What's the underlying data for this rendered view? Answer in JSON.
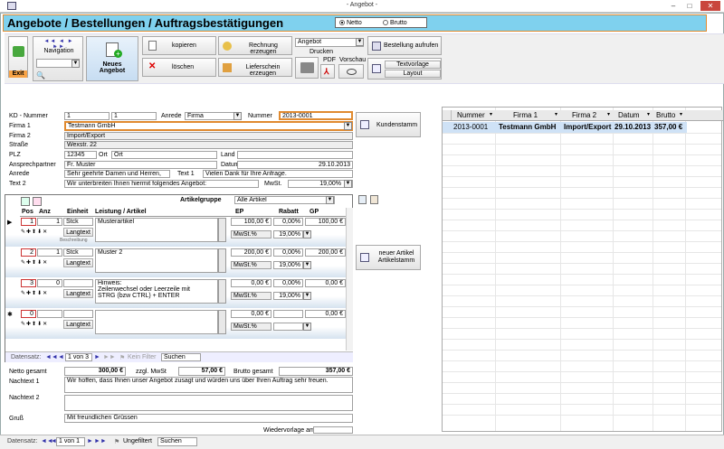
{
  "window": {
    "title": "- Angebot -",
    "min": "–",
    "max": "□",
    "close": "✕"
  },
  "header": {
    "title": "Angebote / Bestellungen / Auftragsbestätigungen",
    "netto": "Netto",
    "brutto": "Brutto"
  },
  "toolbar": {
    "exit": "Exit",
    "navigation": "Navigation",
    "neues_angebot": "Neues\nAngebot",
    "kopieren": "kopieren",
    "loeschen": "löschen",
    "rechnung": "Rechnung erzeugen",
    "lieferschein": "Lieferschein erzeugen",
    "angebot_select": "Angebot",
    "drucken": "Drucken",
    "pdf": "PDF",
    "vorschau": "Vorschau",
    "bestellung": "Bestellung aufrufen",
    "textvorlage": "Textvorlage",
    "layout": "Layout"
  },
  "form": {
    "kd_nummer_label": "KD - Nummer",
    "kd1": "1",
    "kd2": "1",
    "anrede_label": "Anrede",
    "anrede": "Firma",
    "nummer_label": "Nummer",
    "nummer": "2013-0001",
    "firma1_label": "Firma 1",
    "firma1": "Testmann GmbH",
    "firma2_label": "Firma 2",
    "firma2": "Import/Export",
    "strasse_label": "Straße",
    "strasse": "Wexstr. 22",
    "plz_label": "PLZ",
    "plz": "12345",
    "ort_label": "Ort",
    "ort": "Ort",
    "land_label": "Land",
    "ansprech_label": "Ansprechpartner",
    "ansprech": "Fr. Muster",
    "datum_label": "Datum",
    "datum": "29.10.2013",
    "anrede2_label": "Anrede",
    "anrede2": "Sehr geehrte Damen und Herren,",
    "text1_label": "Text 1",
    "text1": "Vielen Dank für Ihre Anfrage.",
    "text2_label": "Text 2",
    "text2": "Wir unterbreiten Ihnen hiermit folgendes Angebot:",
    "mwst_label": "MwSt.",
    "mwst": "19,00%",
    "kundenstamm": "Kundenstamm",
    "neuer_artikel": "neuer Artikel\nArtikelstamm"
  },
  "sub": {
    "artikelgruppe_label": "Artikelgruppe",
    "artikelgruppe": "Alle Artikel",
    "cols": [
      "Pos",
      "Anz",
      "Einheit",
      "Leistung / Artikel",
      "EP",
      "Rabatt",
      "GP"
    ],
    "rows": [
      {
        "pos": "1",
        "anz": "1",
        "einheit": "Stck",
        "text": "Musterartikel",
        "ep": "100,00 €",
        "rabatt": "0,00%",
        "gp": "100,00 €",
        "mwst": "19,00%",
        "langtext": "Langtext",
        "sub": "Beschreibung"
      },
      {
        "pos": "2",
        "anz": "1",
        "einheit": "Stck",
        "text": "Muster 2",
        "ep": "200,00 €",
        "rabatt": "0,00%",
        "gp": "200,00 €",
        "mwst": "19,00%",
        "langtext": "Langtext",
        "sub": ""
      },
      {
        "pos": "3",
        "anz": "0",
        "einheit": "",
        "text": "Hinweis:\nZeilenwechsel oder Leerzeile mit\nSTRG (bzw CTRL) + ENTER",
        "ep": "0,00 €",
        "rabatt": "0,00%",
        "gp": "0,00 €",
        "mwst": "19,00%",
        "langtext": "Langtext",
        "sub": ""
      },
      {
        "pos": "0",
        "anz": "",
        "einheit": "",
        "text": "",
        "ep": "0,00 €",
        "rabatt": "",
        "gp": "0,00 €",
        "mwst": "",
        "langtext": "Langtext",
        "sub": ""
      }
    ],
    "mwst_small": "MwSt.%",
    "nav": {
      "label": "Datensatz:",
      "pos": "1 von 3",
      "filter": "Kein Filter",
      "search": "Suchen"
    }
  },
  "totals": {
    "netto_label": "Netto gesamt",
    "netto": "300,00 €",
    "zzgl_label": "zzgl. MwSt",
    "zzgl": "57,00 €",
    "brutto_label": "Brutto gesamt",
    "brutto": "357,00 €"
  },
  "nach": {
    "n1_label": "Nachtext 1",
    "n1": "Wir hoffen, dass Ihnen unser Angebot zusagt und würden uns über Ihren Auftrag sehr freuen.",
    "n2_label": "Nachtext 2",
    "gruss_label": "Gruß",
    "gruss": "Mit freundlichen Grüssen",
    "wiedervorlage": "Wiedervorlage am"
  },
  "list": {
    "cols": [
      "Nummer",
      "Firma 1",
      "Firma 2",
      "Datum",
      "Brutto"
    ],
    "row": [
      "2013-0001",
      "Testmann GmbH",
      "Import/Export",
      "29.10.2013",
      "357,00 €"
    ]
  },
  "status": {
    "label": "Datensatz:",
    "pos": "1 von 1",
    "filter": "Ungefiltert",
    "search": "Suchen"
  }
}
